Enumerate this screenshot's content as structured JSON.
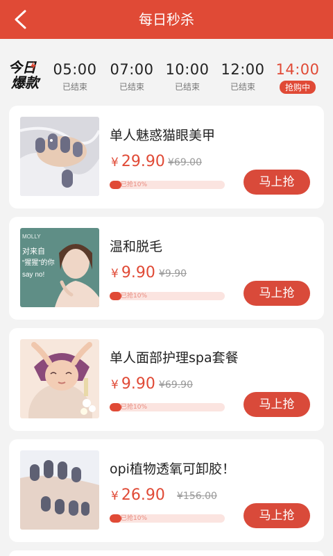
{
  "header": {
    "title": "每日秒杀"
  },
  "flash_logo": {
    "line1": "今日",
    "line2": "爆款"
  },
  "time_slots": [
    {
      "time": "05:00",
      "status": "已结束"
    },
    {
      "time": "07:00",
      "status": "已结束"
    },
    {
      "time": "10:00",
      "status": "已结束"
    },
    {
      "time": "12:00",
      "status": "已结束"
    },
    {
      "time": "14:00",
      "status": "抢购中",
      "active": true
    }
  ],
  "thumb_texts": {
    "hair_removal": [
      "MOLLY",
      "对来自",
      "“猩猩”的你",
      "say no!"
    ]
  },
  "products": [
    {
      "name": "单人魅惑猫眼美甲",
      "currency": "¥",
      "price": "29.90",
      "original_price": "¥69.00",
      "progress_label": "已抢10%",
      "progress": 0.1,
      "buy_label": "马上抢"
    },
    {
      "name": "温和脱毛",
      "currency": "¥",
      "price": "9.90",
      "original_price": "¥9.90",
      "progress_label": "已抢10%",
      "progress": 0.1,
      "buy_label": "马上抢"
    },
    {
      "name": "单人面部护理spa套餐",
      "currency": "¥",
      "price": "9.90",
      "original_price": "¥69.90",
      "progress_label": "已抢10%",
      "progress": 0.1,
      "buy_label": "马上抢"
    },
    {
      "name": "opi植物透氧可卸胶！",
      "currency": "¥",
      "price": "26.90",
      "original_price": "¥156.00",
      "progress_label": "已抢10%",
      "progress": 0.1,
      "buy_label": "马上抢"
    }
  ],
  "colors": {
    "primary": "#e04a36",
    "button": "#d94a3a",
    "progress_track": "#fbe4e0",
    "background": "#f3f3f3"
  }
}
